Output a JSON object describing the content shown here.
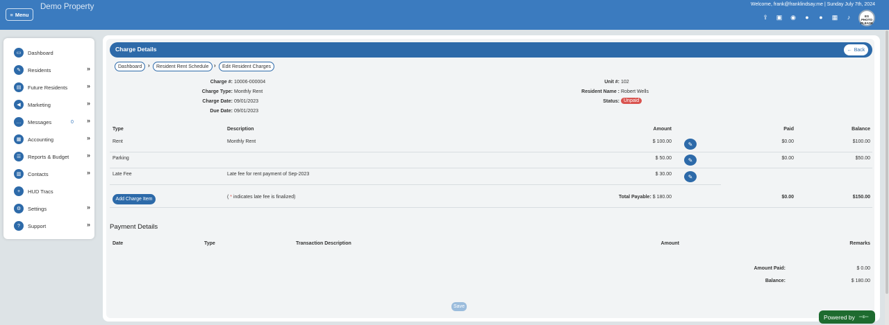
{
  "topbar": {
    "menu_label": "Menu",
    "brand": "Demo Property",
    "welcome": "Welcome, frank@franklindsay.me | Sunday July 7th, 2024",
    "avatar_text": "ES PHOTO PLEASE"
  },
  "sidebar": {
    "items": [
      {
        "label": "Dashboard",
        "icon": "dashboard-icon"
      },
      {
        "label": "Residents",
        "icon": "residents-icon"
      },
      {
        "label": "Future Residents",
        "icon": "future-residents-icon"
      },
      {
        "label": "Marketing",
        "icon": "megaphone-icon"
      },
      {
        "label": "Messages",
        "icon": "message-icon",
        "count": "0"
      },
      {
        "label": "Accounting",
        "icon": "calculator-icon"
      },
      {
        "label": "Reports & Budget",
        "icon": "list-icon"
      },
      {
        "label": "Contacts",
        "icon": "contacts-icon"
      },
      {
        "label": "HUD Tracs",
        "icon": "plus-icon"
      },
      {
        "label": "Settings",
        "icon": "gears-icon"
      },
      {
        "label": "Support",
        "icon": "question-icon"
      }
    ]
  },
  "header": {
    "title": "Charge Details",
    "back": "Back"
  },
  "breadcrumb": [
    "Dashboard",
    "Resident Rent Schedule",
    "Edit Resident Charges"
  ],
  "details": {
    "charge_no_label": "Charge #:",
    "charge_no": "10006-000004",
    "charge_type_label": "Charge Type:",
    "charge_type": "Monthly Rent",
    "charge_date_label": "Charge Date:",
    "charge_date": "09/01/2023",
    "due_date_label": "Due Date:",
    "due_date": "09/01/2023",
    "unit_label": "Unit #:",
    "unit": "102",
    "resident_label": "Resident Name :",
    "resident": "Robert Wells",
    "status_label": "Status:",
    "status": "Unpaid"
  },
  "charges": {
    "headers": {
      "type": "Type",
      "description": "Description",
      "amount": "Amount",
      "paid": "Paid",
      "balance": "Balance"
    },
    "rows": [
      {
        "type": "Rent",
        "description": "Monthly Rent",
        "amount": "$ 100.00",
        "paid": "$0.00",
        "balance": "$100.00"
      },
      {
        "type": "Parking",
        "description": "",
        "amount": "$ 50.00",
        "paid": "$0.00",
        "balance": "$50.00"
      },
      {
        "type": "Late Fee",
        "description": "Late fee for rent payment of Sep-2023",
        "amount": "$ 30.00",
        "paid": "",
        "balance": ""
      }
    ],
    "add_button": "Add Charge Item",
    "note_prefix": "( ",
    "note_star": "*",
    "note_suffix": " indicates late fee is finalized)",
    "total_label": "Total Payable:",
    "total_value": "$ 180.00",
    "total_paid": "$0.00",
    "total_balance": "$150.00"
  },
  "payment": {
    "title": "Payment Details",
    "headers": {
      "date": "Date",
      "type": "Type",
      "description": "Transaction Description",
      "amount": "Amount",
      "remarks": "Remarks"
    },
    "amount_paid_label": "Amount Paid:",
    "amount_paid": "$ 0.00",
    "balance_label": "Balance:",
    "balance": "$ 180.00"
  },
  "save_label": "Save",
  "powered_by": "Powered by",
  "colors": {
    "primary": "#2d6aa9",
    "topbar": "#3b7bbf",
    "unpaid": "#d9534f",
    "powered": "#1e6b2f"
  }
}
